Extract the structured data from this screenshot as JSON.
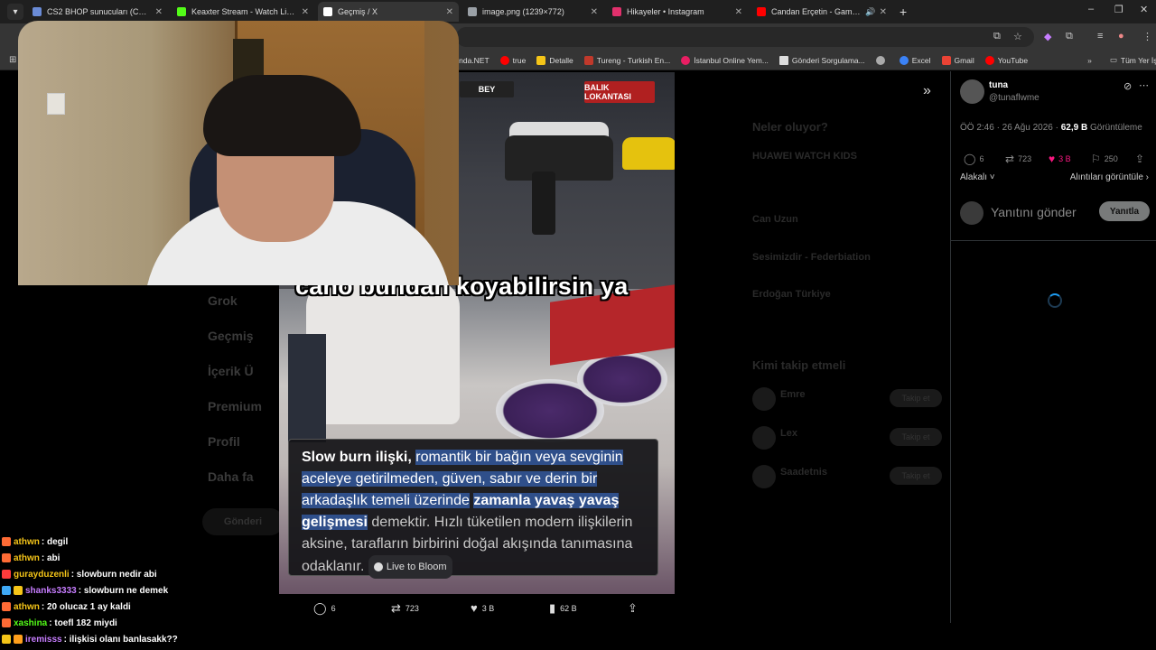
{
  "browser": {
    "tabs": [
      {
        "title": "CS2 BHOP sunucuları (CS2) – C",
        "color": "#6a8bd6",
        "active": false
      },
      {
        "title": "Keaxter Stream - Watch Live on",
        "color": "#53fc18",
        "active": false
      },
      {
        "title": "Geçmiş / X",
        "color": "#ffffff",
        "active": true
      },
      {
        "title": "image.png (1239×772)",
        "color": "#9aa0a6",
        "active": false
      },
      {
        "title": "Hikayeler • Instagram",
        "color": "#e1306c",
        "active": false
      },
      {
        "title": "Candan Erçetin - Gamsız Ha",
        "color": "#ff0000",
        "active": false
      }
    ],
    "new_tab": "+",
    "window_controls": {
      "minimize": "–",
      "maximize": "❐",
      "close": "✕"
    },
    "bookmarks": [
      {
        "label": "unda.NET",
        "color": "#888888"
      },
      {
        "label": "true",
        "color": "#ff0000"
      },
      {
        "label": "Detalle",
        "color": "#f5c518"
      },
      {
        "label": "Tureng - Turkish En...",
        "color": "#c0392b"
      },
      {
        "label": "İstanbul Online Yem...",
        "color": "#e91e63"
      },
      {
        "label": "Gönderi Sorgulama...",
        "color": "#dddddd"
      },
      {
        "label": "",
        "color": "#aaaaaa"
      },
      {
        "label": "Excel",
        "color": "#3b82f6"
      },
      {
        "label": "Gmail",
        "color": "#ea4335"
      },
      {
        "label": "YouTube",
        "color": "#ff0000"
      }
    ],
    "bookmarks_overflow": "»",
    "all_bookmarks": "Tüm Yer İşaretleri"
  },
  "background_page": {
    "left_nav": [
      "Grok",
      "Geçmiş",
      "İçerik Ü",
      "Premium",
      "Profil",
      "Daha fa"
    ],
    "post_button": "Gönderi",
    "trends_title": "Neler oluyor?",
    "trends": [
      "HUAWEI WATCH KIDS",
      "Can Uzun",
      "Sesimizdir - Federbiation",
      "Erdoğan Türkiye"
    ],
    "follow_title": "Kimi takip etmeli",
    "follow_items": [
      {
        "name": "Emre",
        "button": "Takip et"
      },
      {
        "name": "Lex",
        "button": "Takip et"
      },
      {
        "name": "Saadetnis",
        "button": "Takip et"
      }
    ]
  },
  "video": {
    "caption": "cano bundan koyabilirsin ya",
    "shop_signs": [
      "BALIK LOKANTASI",
      "BEY"
    ],
    "info_card": {
      "segments": [
        {
          "text": "Slow burn ilişki,",
          "style": "bold"
        },
        {
          "text": "romantik bir bağın veya sevginin aceleye getirilmeden, güven, sabır ve derin bir arkadaşlık temeli üzerinde",
          "style": "hl"
        },
        {
          "text": "zamanla yavaş yavaş gelişmesi",
          "style": "hl-bold"
        },
        {
          "text": "demektir. Hızlı tüketilen modern ilişkilerin aksine, tarafların birbirini doğal akışında tanımasına odaklanır.",
          "style": "dim"
        }
      ],
      "source": "Live to Bloom"
    },
    "actions": {
      "replies": "6",
      "reposts": "723",
      "likes": "3 B",
      "views": "62 B"
    }
  },
  "tweet_panel": {
    "name": "tuna",
    "handle": "@tunaflwme",
    "time": "ÖÖ 2:46 · 26 Ağu 2026 ·",
    "views": "62,9 B",
    "views_label": "Görüntüleme",
    "replies": "6",
    "reposts": "723",
    "likes": "3 B",
    "bookmarks": "250",
    "sort": "Alakalı",
    "quotes": "Alıntıları görüntüle",
    "reply_placeholder": "Yanıtını gönder",
    "reply_button": "Yanıtla",
    "like_color": "#f91880"
  },
  "chat": [
    {
      "user": "athwn",
      "msg": ": degil",
      "color": "#f5c518",
      "badge": "#ff6b35"
    },
    {
      "user": "athwn",
      "msg": ": abi",
      "color": "#f5c518",
      "badge": "#ff6b35"
    },
    {
      "user": "gurayduzenli",
      "msg": ": slowburn nedir abi",
      "color": "#f5c518",
      "badge": "#ff3b3b"
    },
    {
      "user": "shanks3333",
      "msg": ": slowburn ne demek",
      "color": "#c77dff",
      "badge": "#3fa9f5"
    },
    {
      "user": "athwn",
      "msg": ": 20 olucaz 1 ay kaldi",
      "color": "#f5c518",
      "badge": "#ff6b35"
    },
    {
      "user": "xashina",
      "msg": ": toefl 182 miydi",
      "color": "#53fc18",
      "badge": "#ff6b35"
    },
    {
      "user": "iremisss",
      "msg": ": ilişkisi olanı banlasakk??",
      "color": "#c77dff",
      "badge": "#f5c518"
    }
  ]
}
